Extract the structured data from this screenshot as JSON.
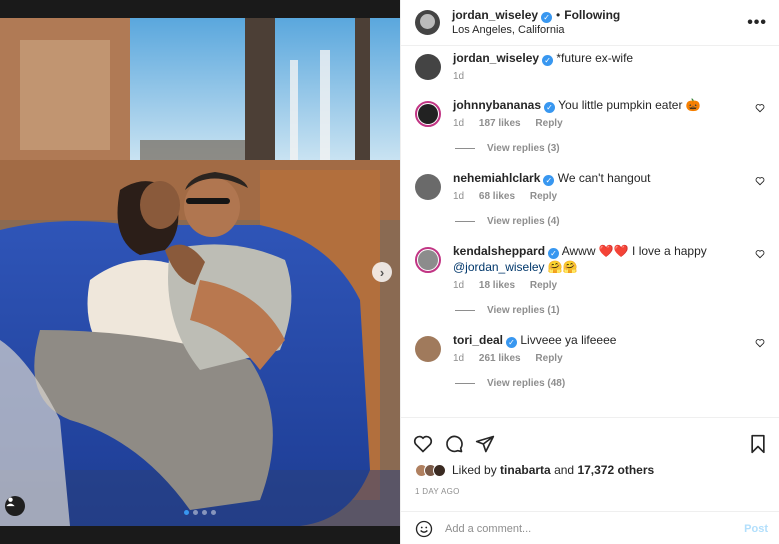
{
  "colors": {
    "accent": "#3897f0",
    "muted": "#8e8e8e",
    "text": "#262626",
    "post_disabled": "#b2dffc"
  },
  "photo": {
    "slide_index": 1,
    "slide_count": 4,
    "next_icon": "chevron-right-icon",
    "tag_icon": "user-tag-icon"
  },
  "header": {
    "username": "jordan_wiseley",
    "separator": "•",
    "follow_status": "Following",
    "location": "Los Angeles, California",
    "more_icon": "more-horizontal-icon",
    "more_label": "•••"
  },
  "caption": {
    "username": "jordan_wiseley",
    "text": "*future ex-wife",
    "time": "1d"
  },
  "comments": [
    {
      "username": "johnnybananas",
      "text": "You little pumpkin eater 🎃",
      "time": "1d",
      "likes": "187 likes",
      "reply": "Reply",
      "replies": "View replies (3)"
    },
    {
      "username": "nehemiahlclark",
      "text": "We can't hangout",
      "time": "1d",
      "likes": "68 likes",
      "reply": "Reply",
      "replies": "View replies (4)"
    },
    {
      "username": "kendalsheppard",
      "text": "Awww ❤️❤️ I love a happy",
      "mention": "@jordan_wiseley",
      "text2": " 🤗🤗",
      "time": "1d",
      "likes": "18 likes",
      "reply": "Reply",
      "replies": "View replies (1)"
    },
    {
      "username": "tori_deal",
      "text": "Livveee ya lifeeee",
      "time": "1d",
      "likes": "261 likes",
      "reply": "Reply",
      "replies": "View replies (48)"
    }
  ],
  "likes": {
    "prefix": "Liked by",
    "user": "tinabarta",
    "and": "and",
    "others": "17,372 others"
  },
  "timestamp": "1 DAY AGO",
  "add_comment": {
    "placeholder": "Add a comment...",
    "post_label": "Post"
  }
}
